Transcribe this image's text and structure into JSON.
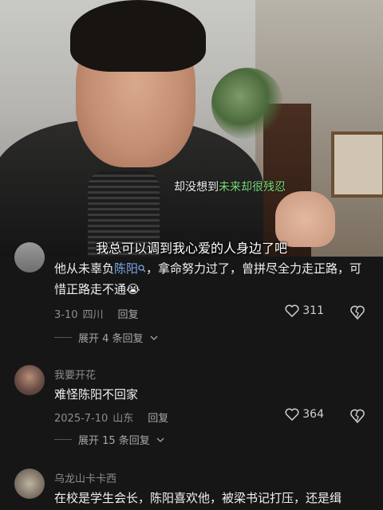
{
  "video": {
    "subtitle_top_pre": "却没想到",
    "subtitle_top_highlight": "未来却很残忍",
    "subtitle_bottom": "我总可以调到我心爱的人身边了吧"
  },
  "comments": [
    {
      "text_pre": "他从未辜负",
      "link": "陈阳",
      "text_post": "，拿命努力过了，曾拼尽全力走正路，可惜正路走不通😭",
      "date": "3-10",
      "location": "四川",
      "reply_label": "回复",
      "likes": "311",
      "expand_label": "展开 4 条回复"
    },
    {
      "username": "我要开花",
      "text": "难怪陈阳不回家",
      "date": "2025-7-10",
      "location": "山东",
      "reply_label": "回复",
      "likes": "364",
      "expand_label": "展开 15 条回复"
    },
    {
      "username": "乌龙山卡卡西",
      "text": "在校是学生会长，陈阳喜欢他，被梁书记打压，还是缉"
    }
  ]
}
